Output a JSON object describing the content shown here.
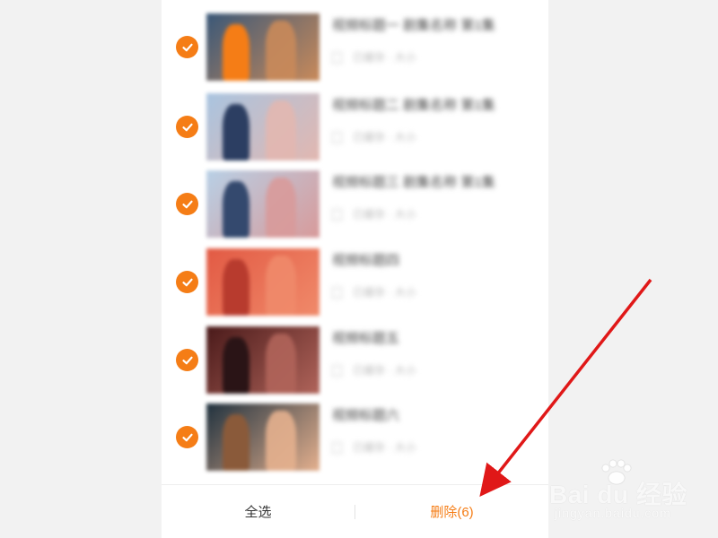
{
  "list": {
    "items": [
      {
        "title": "视频标题一 剧集名称 第1集",
        "meta": "已缓存 · 大小",
        "checked": true,
        "thumb_colors": [
          "#3a5878",
          "#c98a5a",
          "#f57d16"
        ]
      },
      {
        "title": "视频标题二 剧集名称 第1集",
        "meta": "已缓存 · 大小",
        "checked": true,
        "thumb_colors": [
          "#a9c4e0",
          "#e2b7b0",
          "#2c3e62"
        ]
      },
      {
        "title": "视频标题三 剧集名称 第1集",
        "meta": "已缓存 · 大小",
        "checked": true,
        "thumb_colors": [
          "#b8d0e6",
          "#d89a9a",
          "#34496e"
        ]
      },
      {
        "title": "视频标题四",
        "meta": "已缓存 · 大小",
        "checked": true,
        "thumb_colors": [
          "#e25a44",
          "#f08a6a",
          "#b83b2e"
        ]
      },
      {
        "title": "视频标题五",
        "meta": "已缓存 · 大小",
        "checked": true,
        "thumb_colors": [
          "#4a1a1a",
          "#b0645a",
          "#2a1416"
        ]
      },
      {
        "title": "视频标题六",
        "meta": "已缓存 · 大小",
        "checked": true,
        "thumb_colors": [
          "#20323f",
          "#e4b08e",
          "#8a5a3a"
        ]
      }
    ]
  },
  "bottom_bar": {
    "select_all_label": "全选",
    "delete_label": "删除(6)"
  },
  "watermark": {
    "main": "Bai du 经验",
    "sub": "jingyan.baidu.com"
  },
  "colors": {
    "accent": "#f57d16",
    "arrow": "#e01818"
  }
}
